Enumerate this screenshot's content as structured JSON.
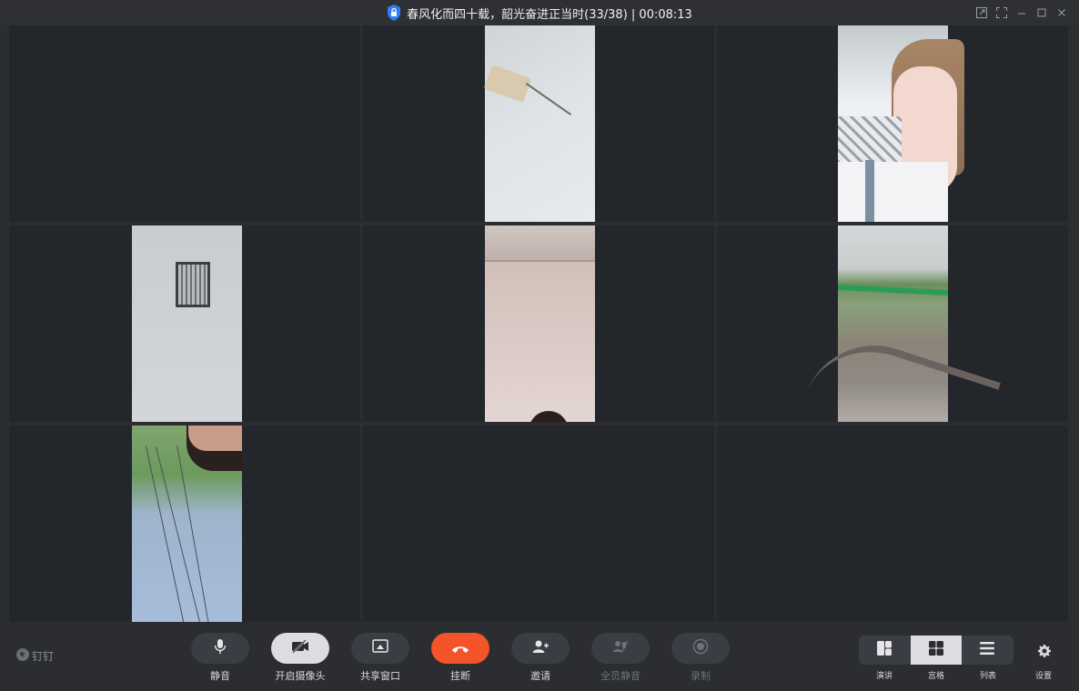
{
  "title": "春风化而四十载，韶光奋进正当时(33/38) | 00:08:13",
  "brand": "钉钉",
  "controls": {
    "mute": "静音",
    "camera": "开启摄像头",
    "share": "共享窗口",
    "hangup": "挂断",
    "invite": "邀请",
    "mute_all": "全员静音",
    "record": "录制"
  },
  "layout_modes": {
    "speaker": "演讲",
    "grid": "宫格",
    "list": "列表"
  },
  "settings": "设置",
  "colors": {
    "accent_hangup": "#f3542a",
    "shield": "#2d7ff9"
  }
}
